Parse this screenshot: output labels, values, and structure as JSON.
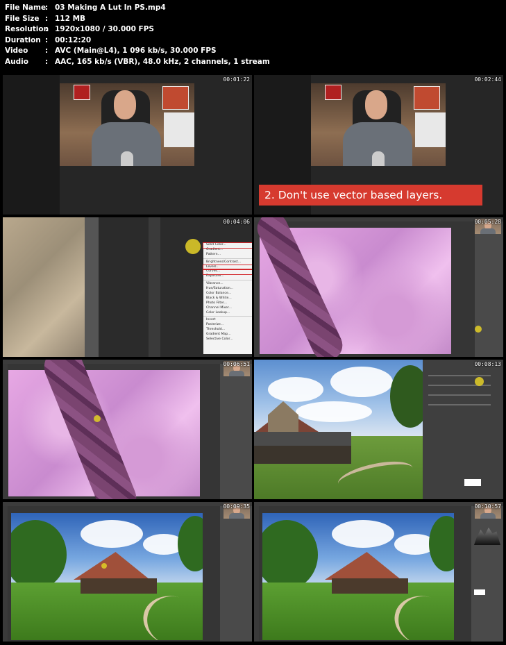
{
  "meta": [
    {
      "key": "File Name",
      "sep": ":",
      "value": "03 Making A Lut In PS.mp4"
    },
    {
      "key": "File Size",
      "sep": ":",
      "value": "112 MB"
    },
    {
      "key": "Resolution",
      "sep": ":",
      "value": "1920x1080 / 30.000 FPS"
    },
    {
      "key": "Duration",
      "sep": ":",
      "value": "00:12:20"
    },
    {
      "key": "Video",
      "sep": ":",
      "value": "AVC (Main@L4), 1 096 kb/s, 30.000 FPS"
    },
    {
      "key": "Audio",
      "sep": ":",
      "value": "AAC, 165 kb/s (VBR), 48.0 kHz, 2 channels, 1 stream"
    }
  ],
  "thumbs": [
    {
      "timestamp": "00:01:22"
    },
    {
      "timestamp": "00:02:44",
      "caption": "2.  Don't use vector based layers."
    },
    {
      "timestamp": "00:04:06"
    },
    {
      "timestamp": "00:05:28"
    },
    {
      "timestamp": "00:06:51"
    },
    {
      "timestamp": "00:08:13"
    },
    {
      "timestamp": "00:09:35"
    },
    {
      "timestamp": "00:10:57"
    }
  ],
  "adjustment_menu": [
    {
      "label": "Solid Color...",
      "highlight": true
    },
    {
      "label": "Gradient..."
    },
    {
      "label": "Pattern..."
    },
    {
      "sep": true
    },
    {
      "label": "Brightness/Contrast..."
    },
    {
      "label": "Levels...",
      "highlight": true
    },
    {
      "label": "Curves...",
      "highlight": true
    },
    {
      "label": "Exposure..."
    },
    {
      "sep": true
    },
    {
      "label": "Vibrance..."
    },
    {
      "label": "Hue/Saturation..."
    },
    {
      "label": "Color Balance..."
    },
    {
      "label": "Black & White..."
    },
    {
      "label": "Photo Filter..."
    },
    {
      "label": "Channel Mixer..."
    },
    {
      "label": "Color Lookup..."
    },
    {
      "sep": true
    },
    {
      "label": "Invert"
    },
    {
      "label": "Posterize..."
    },
    {
      "label": "Threshold..."
    },
    {
      "label": "Gradient Map..."
    },
    {
      "label": "Selective Color..."
    }
  ]
}
